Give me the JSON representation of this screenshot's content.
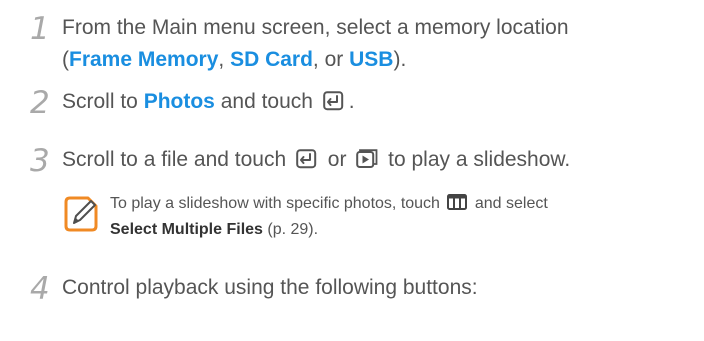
{
  "steps": [
    {
      "num": "1",
      "line1": "From the Main menu screen, select a memory location",
      "open_paren": "(",
      "kw1": "Frame Memory",
      "sep1": ", ",
      "kw2": "SD Card",
      "sep2": ", or ",
      "kw3": "USB",
      "close": ")."
    },
    {
      "num": "2",
      "pre": "Scroll to ",
      "kw": "Photos",
      "mid": " and touch ",
      "post": "."
    },
    {
      "num": "3",
      "pre": "Scroll to a file and touch ",
      "or": " or ",
      "post": " to play a slideshow."
    },
    {
      "num": "4",
      "text": "Control playback using the following buttons:"
    }
  ],
  "note": {
    "line1_pre": "To play a slideshow with specific photos, touch ",
    "line1_post": " and select",
    "bold": "Select Multiple Files",
    "page_ref": " (p. 29)."
  },
  "icons": {
    "enter": "enter-icon",
    "play": "play-icon",
    "menu": "menu-icon",
    "note": "note-pencil-icon"
  },
  "colors": {
    "keyword": "#1a8ee0",
    "note_icon": "#f08a24",
    "step_number": "#a9a9a9"
  }
}
